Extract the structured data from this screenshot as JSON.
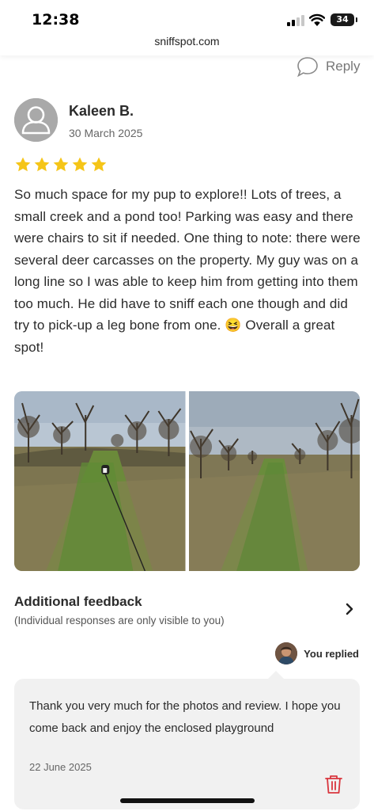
{
  "status_bar": {
    "time": "12:38",
    "url": "sniffspot.com",
    "battery": "34"
  },
  "reply_link": {
    "label": "Reply",
    "icon": "speech-bubble-icon"
  },
  "review": {
    "name": "Kaleen B.",
    "date": "30 March 2025",
    "rating": 5,
    "rating_max": 5,
    "star_color": "#F5C518",
    "text": "So much space for my pup to explore!! Lots of trees, a small creek and a pond too! Parking was easy and there were chairs to sit if needed. One thing to note: there were several deer carcasses on the property. My guy was on a long line so I was able to keep him from getting into them too much. He did have to sniff each one though and did try to pick-up a leg bone from one. 😆 Overall a great spot!",
    "photos": [
      {
        "icon": "orchard-photo-with-dog"
      },
      {
        "icon": "orchard-photo"
      }
    ]
  },
  "feedback": {
    "title": "Additional feedback",
    "subtitle": "(Individual responses are only visible to you)"
  },
  "host_reply": {
    "label": "You replied",
    "text": "Thank you very much for the photos and review.  I hope you come back and enjoy the enclosed playground",
    "date": "22 June 2025",
    "delete_color": "#D9363E"
  }
}
